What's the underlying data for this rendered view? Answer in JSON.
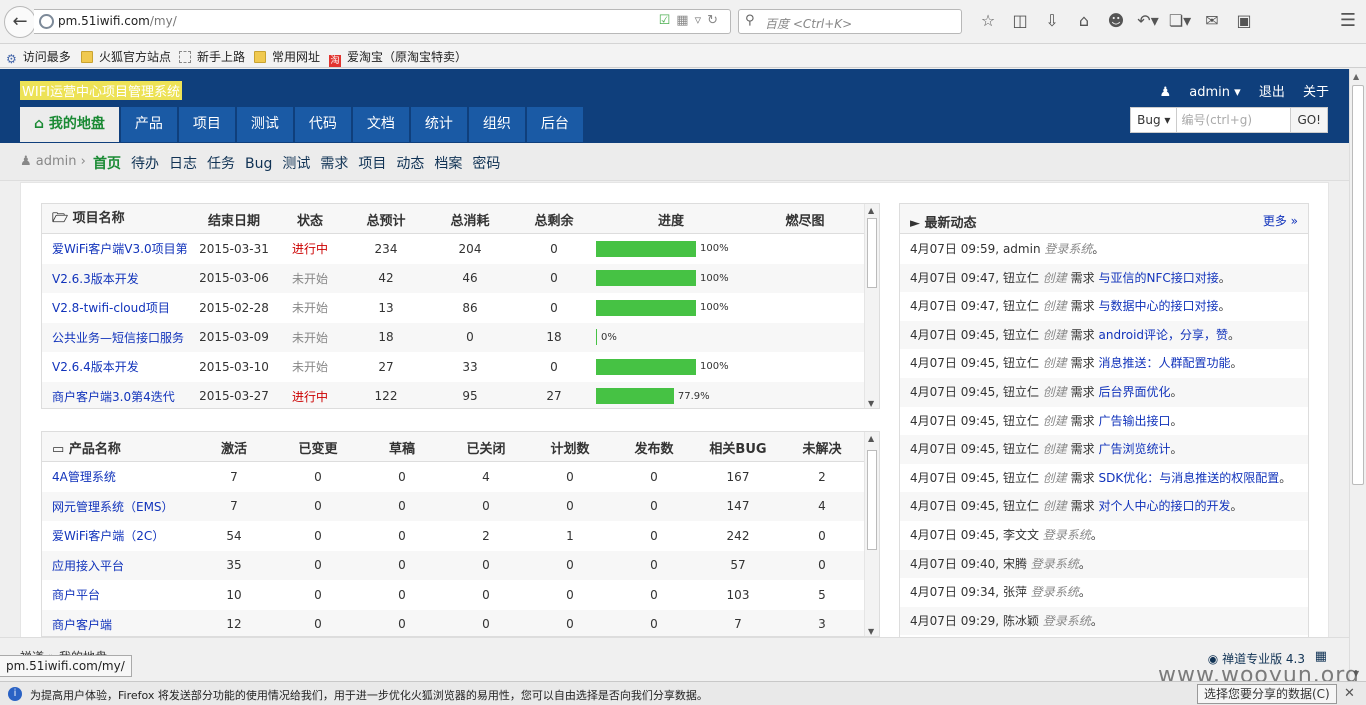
{
  "browser": {
    "url_host": "pm.51iwifi.com",
    "url_path": "/my/",
    "search_placeholder": "百度 <Ctrl+K>",
    "bookmarks": [
      "访问最多",
      "火狐官方站点",
      "新手上路",
      "常用网址",
      "爱淘宝（原淘宝特卖）"
    ],
    "status_url": "pm.51iwifi.com/my/",
    "notice_text": "为提高用户体验，Firefox 将发送部分功能的使用情况给我们，用于进一步优化火狐浏览器的易用性，您可以自由选择是否向我们分享数据。",
    "notice_button": "选择您要分享的数据(C)",
    "watermark": "www.wooyun.org"
  },
  "header": {
    "brand": "WIFI运营中心项目管理系统",
    "user": "admin",
    "logout": "退出",
    "about": "关于",
    "nav": [
      "我的地盘",
      "产品",
      "项目",
      "测试",
      "代码",
      "文档",
      "统计",
      "组织",
      "后台"
    ],
    "search_type": "Bug",
    "search_placeholder": "编号(ctrl+g)",
    "go": "GO!"
  },
  "subnav": {
    "user": "admin",
    "items": [
      "首页",
      "待办",
      "日志",
      "任务",
      "Bug",
      "测试",
      "需求",
      "项目",
      "动态",
      "档案",
      "密码"
    ]
  },
  "projects": {
    "headers": [
      "项目名称",
      "结束日期",
      "状态",
      "总预计",
      "总消耗",
      "总剩余",
      "进度",
      "燃尽图"
    ],
    "rows": [
      {
        "name": "爱WiFi客户端V3.0项目第",
        "end": "2015-03-31",
        "status": "进行中",
        "est": "234",
        "used": "204",
        "left": "0",
        "progress": 100,
        "progress_label": "100%"
      },
      {
        "name": "V2.6.3版本开发",
        "end": "2015-03-06",
        "status": "未开始",
        "est": "42",
        "used": "46",
        "left": "0",
        "progress": 100,
        "progress_label": "100%"
      },
      {
        "name": "V2.8-twifi-cloud项目",
        "end": "2015-02-28",
        "status": "未开始",
        "est": "13",
        "used": "86",
        "left": "0",
        "progress": 100,
        "progress_label": "100%"
      },
      {
        "name": "公共业务—短信接口服务",
        "end": "2015-03-09",
        "status": "未开始",
        "est": "18",
        "used": "0",
        "left": "18",
        "progress": 0,
        "progress_label": "0%"
      },
      {
        "name": "V2.6.4版本开发",
        "end": "2015-03-10",
        "status": "未开始",
        "est": "27",
        "used": "33",
        "left": "0",
        "progress": 100,
        "progress_label": "100%"
      },
      {
        "name": "商户客户端3.0第4迭代",
        "end": "2015-03-27",
        "status": "进行中",
        "est": "122",
        "used": "95",
        "left": "27",
        "progress": 77.9,
        "progress_label": "77.9%"
      }
    ]
  },
  "products": {
    "headers": [
      "产品名称",
      "激活",
      "已变更",
      "草稿",
      "已关闭",
      "计划数",
      "发布数",
      "相关BUG",
      "未解决"
    ],
    "rows": [
      [
        "4A管理系统",
        "7",
        "0",
        "0",
        "4",
        "0",
        "0",
        "167",
        "2"
      ],
      [
        "网元管理系统（EMS）",
        "7",
        "0",
        "0",
        "0",
        "0",
        "0",
        "147",
        "4"
      ],
      [
        "爱WiFi客户端（2C）",
        "54",
        "0",
        "0",
        "2",
        "1",
        "0",
        "242",
        "0"
      ],
      [
        "应用接入平台",
        "35",
        "0",
        "0",
        "0",
        "0",
        "0",
        "57",
        "0"
      ],
      [
        "商户平台",
        "10",
        "0",
        "0",
        "0",
        "0",
        "0",
        "103",
        "5"
      ],
      [
        "商户客户端",
        "12",
        "0",
        "0",
        "0",
        "0",
        "0",
        "7",
        "3"
      ]
    ]
  },
  "dynamics": {
    "title": "最新动态",
    "more": "更多",
    "items": [
      {
        "time": "4月07日 09:59,",
        "who": "admin",
        "action": "登录系统",
        "type": "",
        "object": "",
        "end": "。"
      },
      {
        "time": "4月07日 09:47,",
        "who": "钮立仁",
        "action": "创建",
        "type": "需求",
        "object": "与亚信的NFC接口对接",
        "end": "。"
      },
      {
        "time": "4月07日 09:47,",
        "who": "钮立仁",
        "action": "创建",
        "type": "需求",
        "object": "与数据中心的接口对接",
        "end": "。"
      },
      {
        "time": "4月07日 09:45,",
        "who": "钮立仁",
        "action": "创建",
        "type": "需求",
        "object": "android评论，分享，赞",
        "end": "。"
      },
      {
        "time": "4月07日 09:45,",
        "who": "钮立仁",
        "action": "创建",
        "type": "需求",
        "object": "消息推送：人群配置功能",
        "end": "。"
      },
      {
        "time": "4月07日 09:45,",
        "who": "钮立仁",
        "action": "创建",
        "type": "需求",
        "object": "后台界面优化",
        "end": "。"
      },
      {
        "time": "4月07日 09:45,",
        "who": "钮立仁",
        "action": "创建",
        "type": "需求",
        "object": "广告输出接口",
        "end": "。"
      },
      {
        "time": "4月07日 09:45,",
        "who": "钮立仁",
        "action": "创建",
        "type": "需求",
        "object": "广告浏览统计",
        "end": "。"
      },
      {
        "time": "4月07日 09:45,",
        "who": "钮立仁",
        "action": "创建",
        "type": "需求",
        "object": "SDK优化：与消息推送的权限配置",
        "end": "。"
      },
      {
        "time": "4月07日 09:45,",
        "who": "钮立仁",
        "action": "创建",
        "type": "需求",
        "object": "对个人中心的接口的开发",
        "end": "。"
      },
      {
        "time": "4月07日 09:45,",
        "who": "李文文",
        "action": "登录系统",
        "type": "",
        "object": "",
        "end": "。"
      },
      {
        "time": "4月07日 09:40,",
        "who": "宋腾",
        "action": "登录系统",
        "type": "",
        "object": "",
        "end": "。"
      },
      {
        "time": "4月07日 09:34,",
        "who": "张萍",
        "action": "登录系统",
        "type": "",
        "object": "",
        "end": "。"
      },
      {
        "time": "4月07日 09:29,",
        "who": "陈冰颖",
        "action": "登录系统",
        "type": "",
        "object": "",
        "end": "。"
      }
    ]
  },
  "footer": {
    "crumb": "禅道  »  我的地盘",
    "version": "禅道专业版 4.3"
  },
  "colors": {
    "header_bg": "#0f3f7c",
    "nav_bg": "#1a5aa5",
    "progress": "#46c244",
    "link": "#1133bb",
    "doing": "#cc0000"
  }
}
